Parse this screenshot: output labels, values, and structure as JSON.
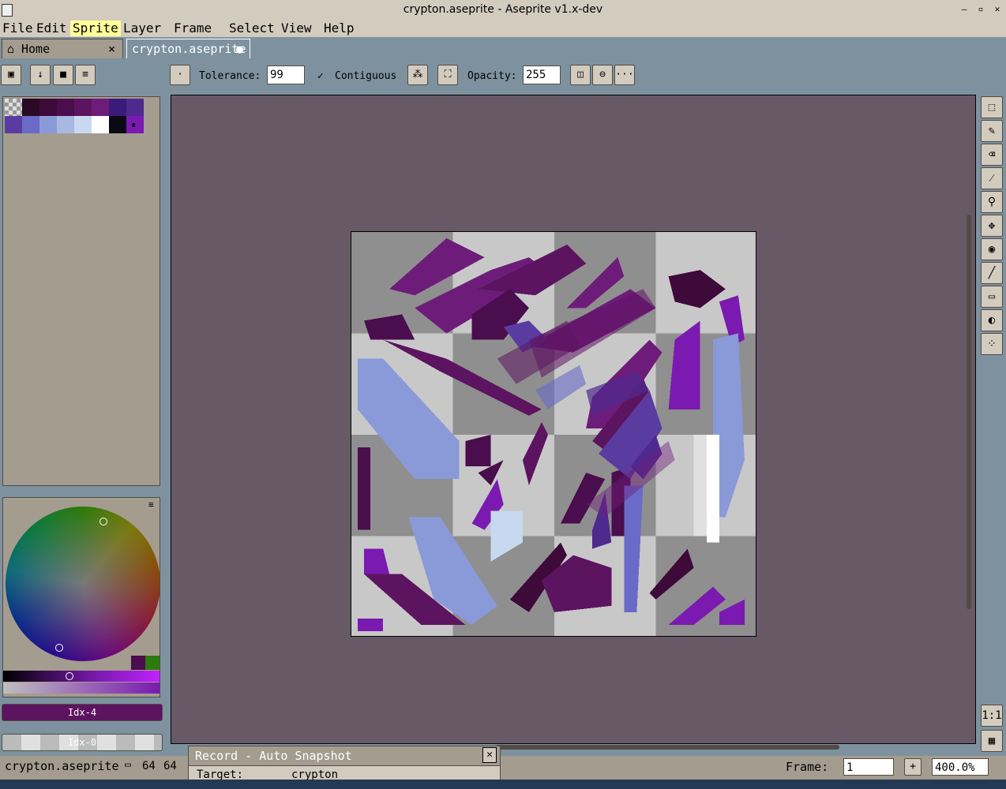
{
  "window": {
    "title": "crypton.aseprite - Aseprite v1.x-dev",
    "controls": [
      "minimize",
      "maximize",
      "close"
    ]
  },
  "menu": {
    "items": [
      "File",
      "Edit",
      "Sprite",
      "Layer",
      "Frame",
      "Select",
      "View",
      "Help"
    ],
    "active": "Sprite"
  },
  "tabs": [
    {
      "label": "Home",
      "icon": "home-icon",
      "close": "×"
    },
    {
      "label": "crypton.aseprite",
      "icon": "modified-dot-icon"
    }
  ],
  "toolbar": {
    "tolerance_label": "Tolerance:",
    "tolerance_value": "99",
    "contiguous_label": "Contiguous",
    "contiguous_checked": true,
    "opacity_label": "Opacity:",
    "opacity_value": "255",
    "more_label": "···"
  },
  "palette": {
    "colors": [
      "#2a0a24",
      "#3e0a3a",
      "#4a0d4d",
      "#5c1460",
      "#6e1c7a",
      "#3a1a7a",
      "#4e2a8e",
      "#5a3ca0",
      "#6a6ac8",
      "#8a9ad8",
      "#a8b8e0",
      "#c8d8f0",
      "#ffffff",
      "#0a0a14",
      "#7a1ab0"
    ],
    "menu_label": "⏸"
  },
  "colorbars": {
    "foreground_label": "Idx-4",
    "foreground_color": "#5c1460",
    "background_label": "Idx-0"
  },
  "tools": [
    "rectangular-marquee-icon",
    "pencil-icon",
    "eraser-icon",
    "eyedropper-icon",
    "zoom-icon",
    "move-icon",
    "paint-bucket-icon",
    "line-icon",
    "rectangle-icon",
    "blur-icon",
    "spray-icon"
  ],
  "statusbar": {
    "filename": "crypton.aseprite",
    "size_w": "64",
    "size_h": "64",
    "frame_label": "Frame:",
    "frame_value": "1",
    "zoom_value": "400.0%"
  },
  "record": {
    "title": "Record - Auto Snapshot",
    "target_label": "Target:",
    "target_value": "crypton"
  },
  "zoom_buttons": {
    "one_to_one": "1:1"
  }
}
